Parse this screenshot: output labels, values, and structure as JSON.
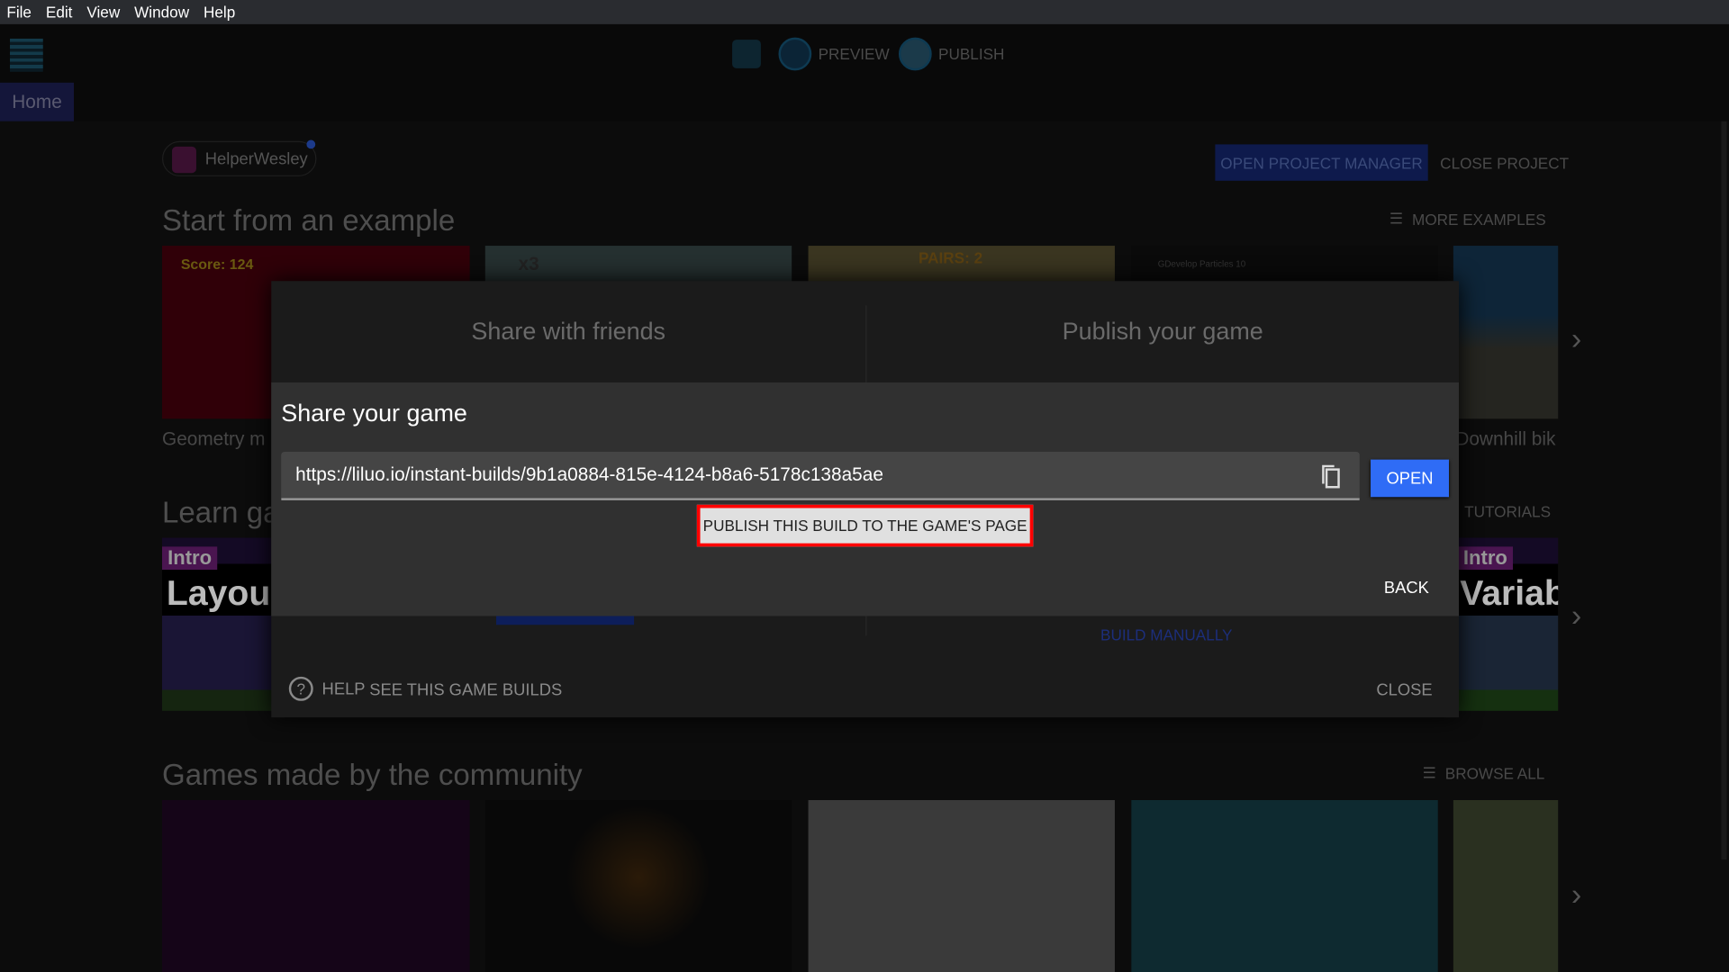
{
  "menu": [
    "File",
    "Edit",
    "View",
    "Window",
    "Help"
  ],
  "toolbar": {
    "preview": "PREVIEW",
    "publish": "PUBLISH"
  },
  "tabs": {
    "home": "Home"
  },
  "user": {
    "name": "HelperWesley"
  },
  "header": {
    "open_project_manager": "OPEN PROJECT MANAGER",
    "close_project": "CLOSE PROJECT"
  },
  "examples": {
    "title": "Start from an example",
    "more": "MORE EXAMPLES",
    "cards": [
      {
        "label": "Geometry m",
        "overlay": "Score: 124"
      },
      {
        "label": "",
        "overlay": "x3"
      },
      {
        "label": "",
        "overlay": "PAIRS: 2"
      },
      {
        "label": "",
        "overlay": "GDevelop Particles 10"
      },
      {
        "label": "Downhill bik",
        "overlay": ""
      }
    ]
  },
  "learn": {
    "title": "Learn ga",
    "more": "TUTORIALS",
    "cards": [
      {
        "badge": "Intro",
        "overlay": "Layou"
      },
      {
        "badge": "Intro",
        "overlay": "Variab"
      }
    ]
  },
  "community": {
    "title": "Games made by the community",
    "more": "BROWSE ALL"
  },
  "dialog": {
    "tabs": [
      "Share with friends",
      "Publish your game"
    ],
    "title": "Share your game",
    "url": "https://liluo.io/instant-builds/9b1a0884-815e-4124-b8a6-5178c138a5ae",
    "open": "OPEN",
    "publish_build": "PUBLISH THIS BUILD TO THE GAME'S PAGE",
    "back": "BACK",
    "build_manually": "BUILD MANUALLY",
    "help": "HELP",
    "see_builds": "SEE THIS GAME BUILDS",
    "close": "CLOSE"
  },
  "colors": {
    "accent": "#2f6cf6",
    "highlight": "#ff0000"
  }
}
